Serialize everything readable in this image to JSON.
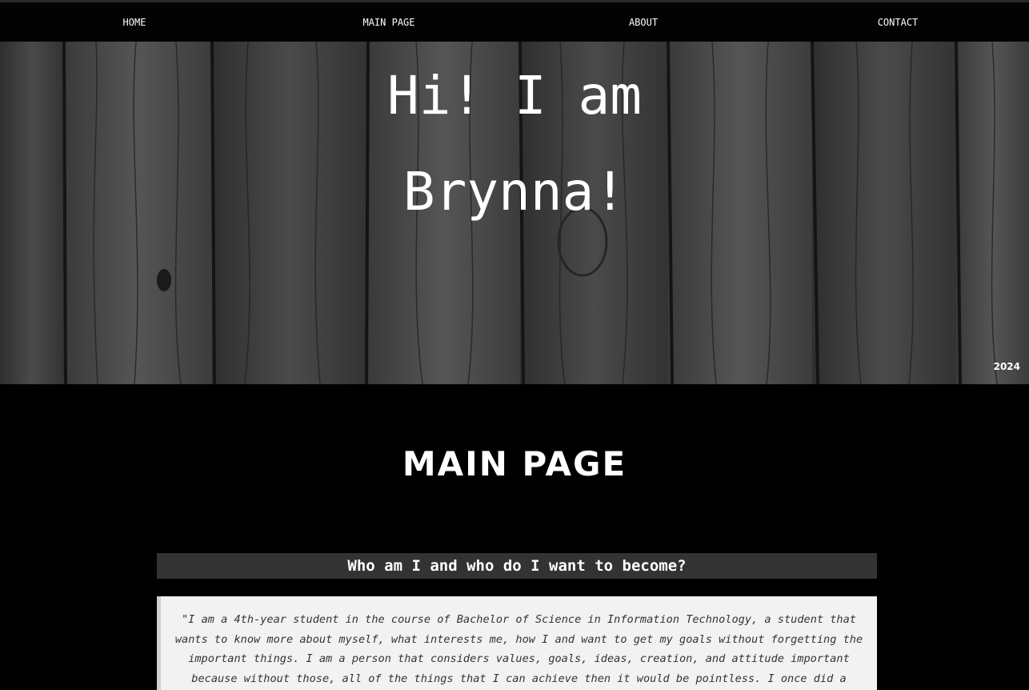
{
  "nav": {
    "items": [
      {
        "label": "HOME"
      },
      {
        "label": "MAIN PAGE"
      },
      {
        "label": "ABOUT"
      },
      {
        "label": "CONTACT"
      }
    ]
  },
  "hero": {
    "title_line1": "Hi! I am",
    "title_line2": "Brynna!",
    "year": "2024",
    "background": "dark-wood-planks-image"
  },
  "main": {
    "heading": "MAIN PAGE",
    "section_title": "Who am I and who do I want to become?",
    "quote": "\"I am a 4th-year student in the course of Bachelor of Science in Information Technology, a student that wants to know more about myself, what interests me, how I and want to get my goals without forgetting the important things. I am a person that considers values, goals, ideas, creation, and attitude important because without those, all of the things that I can achieve then it would be pointless. I once did a small"
  },
  "colors": {
    "background": "#000000",
    "navbar": "#030303",
    "section_bar": "#333333",
    "quote_bg": "#f2f2f2",
    "quote_text": "#333333"
  }
}
